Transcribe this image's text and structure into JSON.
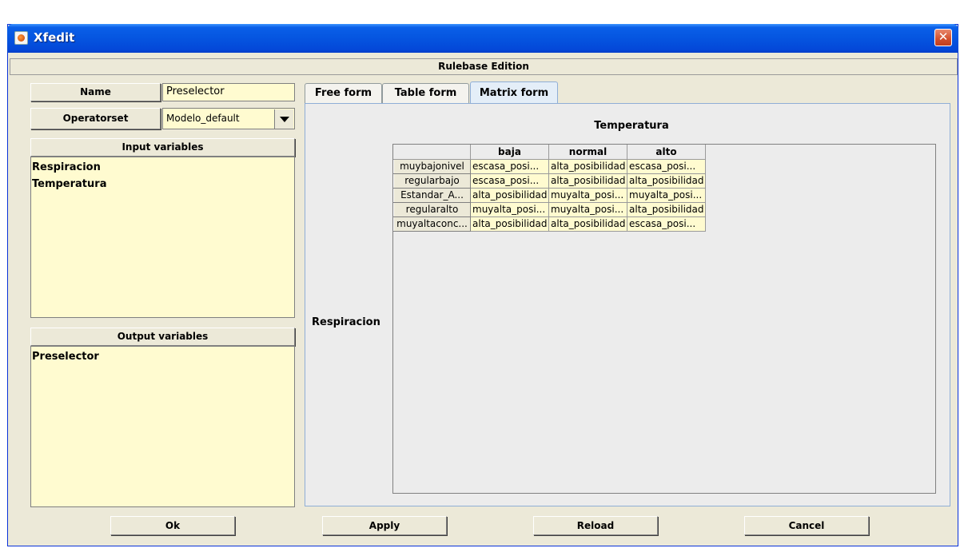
{
  "window": {
    "title": "Xfedit",
    "close_glyph": "✕",
    "icon": "java-cup-icon"
  },
  "header": {
    "title": "Rulebase Edition"
  },
  "left": {
    "name_label": "Name",
    "name_value": "Preselector",
    "operatorset_label": "Operatorset",
    "operatorset_value": "Modelo_default",
    "input_label": "Input variables",
    "input_items": [
      "Respiracion",
      "Temperatura"
    ],
    "output_label": "Output variables",
    "output_items": [
      "Preselector"
    ]
  },
  "tabs": [
    {
      "label": "Free form",
      "active": false
    },
    {
      "label": "Table form",
      "active": false
    },
    {
      "label": "Matrix form",
      "active": true
    }
  ],
  "matrix": {
    "column_variable": "Temperatura",
    "row_variable": "Respiracion",
    "columns": [
      "baja",
      "normal",
      "alto"
    ],
    "rows": [
      {
        "label": "muybajonivel",
        "cells": [
          "escasa_posi...",
          "alta_posibilidad",
          "escasa_posi..."
        ]
      },
      {
        "label": "regularbajo",
        "cells": [
          "escasa_posi...",
          "alta_posibilidad",
          "alta_posibilidad"
        ]
      },
      {
        "label": "Estandar_A...",
        "cells": [
          "alta_posibilidad",
          "muyalta_posi...",
          "muyalta_posi..."
        ]
      },
      {
        "label": "regularalto",
        "cells": [
          "muyalta_posi...",
          "muyalta_posi...",
          "alta_posibilidad"
        ]
      },
      {
        "label": "muyaltaconc...",
        "cells": [
          "alta_posibilidad",
          "alta_posibilidad",
          "escasa_posi..."
        ]
      }
    ]
  },
  "buttons": {
    "ok": "Ok",
    "apply": "Apply",
    "reload": "Reload",
    "cancel": "Cancel"
  }
}
